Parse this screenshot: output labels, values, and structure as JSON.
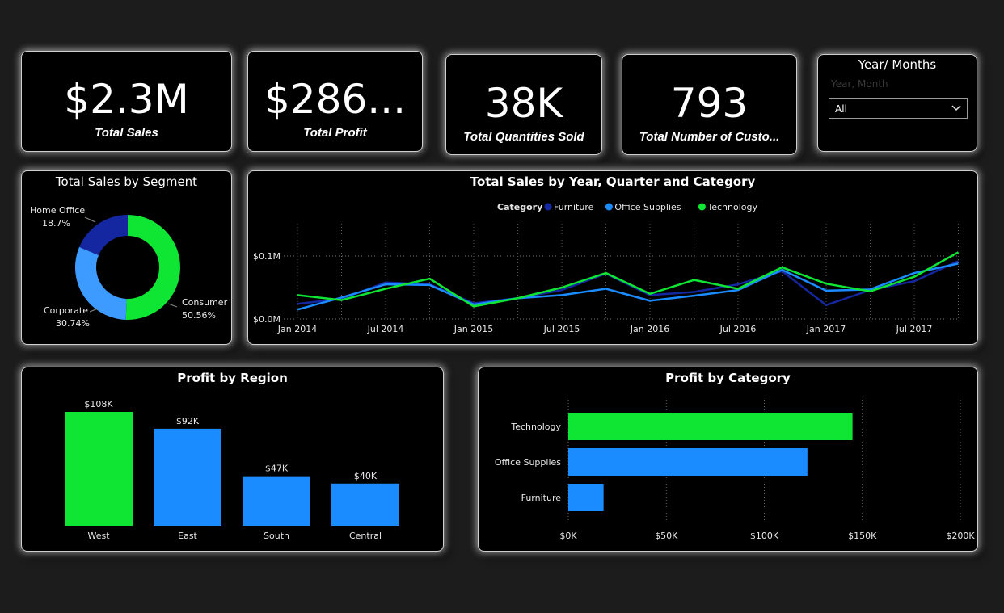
{
  "kpis": [
    {
      "value": "$2.3M",
      "label": "Total Sales"
    },
    {
      "value": "$286...",
      "label": "Total Profit"
    },
    {
      "value": "38K",
      "label": "Total Quantities Sold"
    },
    {
      "value": "793",
      "label": "Total Number of Custo..."
    }
  ],
  "slicer": {
    "title": "Year/ Months",
    "field_placeholder": "Year, Month",
    "selected": "All"
  },
  "colors": {
    "green": "#0ee633",
    "blue": "#1a8cff",
    "light_blue": "#3d9bff",
    "dark_blue": "#1527a0"
  },
  "chart_data": [
    {
      "id": "segment",
      "type": "pie",
      "title": "Total Sales by Segment",
      "style": "donut",
      "slices": [
        {
          "name": "Consumer",
          "value": 50.56,
          "label": "50.56%",
          "color": "#0ee633"
        },
        {
          "name": "Corporate",
          "value": 30.74,
          "label": "30.74%",
          "color": "#3d9bff"
        },
        {
          "name": "Home Office",
          "value": 18.7,
          "label": "18.7%",
          "color": "#1527a0"
        }
      ]
    },
    {
      "id": "trend",
      "type": "line",
      "title": "Total Sales by Year, Quarter and Category",
      "legend_title": "Category",
      "legend_position": "top-center",
      "x": [
        "2014 Q1",
        "2014 Q2",
        "2014 Q3",
        "2014 Q4",
        "2015 Q1",
        "2015 Q2",
        "2015 Q3",
        "2015 Q4",
        "2016 Q1",
        "2016 Q2",
        "2016 Q3",
        "2016 Q4",
        "2017 Q1",
        "2017 Q2",
        "2017 Q3",
        "2017 Q4"
      ],
      "x_tick_labels": [
        "Jan 2014",
        "Jul 2014",
        "Jan 2015",
        "Jul 2015",
        "Jan 2016",
        "Jul 2016",
        "Jan 2017",
        "Jul 2017"
      ],
      "y_tick_labels": [
        "$0.0M",
        "$0.1M"
      ],
      "ylim": [
        0,
        0.1
      ],
      "unit": "$M",
      "grid": true,
      "series": [
        {
          "name": "Furniture",
          "color": "#1527a0",
          "values": [
            0.024,
            0.032,
            0.058,
            0.055,
            0.025,
            0.033,
            0.046,
            0.072,
            0.038,
            0.043,
            0.055,
            0.076,
            0.022,
            0.046,
            0.06,
            0.092
          ]
        },
        {
          "name": "Office Supplies",
          "color": "#1a8cff",
          "values": [
            0.015,
            0.034,
            0.055,
            0.054,
            0.023,
            0.033,
            0.038,
            0.048,
            0.029,
            0.037,
            0.046,
            0.078,
            0.045,
            0.047,
            0.073,
            0.088
          ]
        },
        {
          "name": "Technology",
          "color": "#0ee633",
          "values": [
            0.038,
            0.03,
            0.048,
            0.064,
            0.02,
            0.033,
            0.05,
            0.073,
            0.04,
            0.062,
            0.048,
            0.082,
            0.056,
            0.044,
            0.067,
            0.106
          ]
        }
      ]
    },
    {
      "id": "region",
      "type": "bar",
      "title": "Profit by Region",
      "categories": [
        "West",
        "East",
        "South",
        "Central"
      ],
      "values": [
        108,
        92,
        47,
        40
      ],
      "data_labels": [
        "$108K",
        "$92K",
        "$47K",
        "$40K"
      ],
      "colors": [
        "#0ee633",
        "#1a8cff",
        "#1a8cff",
        "#1a8cff"
      ],
      "unit": "$K",
      "ylim": [
        0,
        108
      ]
    },
    {
      "id": "category",
      "type": "bar",
      "orientation": "horizontal",
      "title": "Profit by Category",
      "categories": [
        "Technology",
        "Office Supplies",
        "Furniture"
      ],
      "values": [
        145,
        122,
        18
      ],
      "colors": [
        "#0ee633",
        "#1a8cff",
        "#1a8cff"
      ],
      "x_tick_labels": [
        "$0K",
        "$50K",
        "$100K",
        "$150K",
        "$200K"
      ],
      "xlim": [
        0,
        200
      ],
      "unit": "$K",
      "grid": true
    }
  ]
}
